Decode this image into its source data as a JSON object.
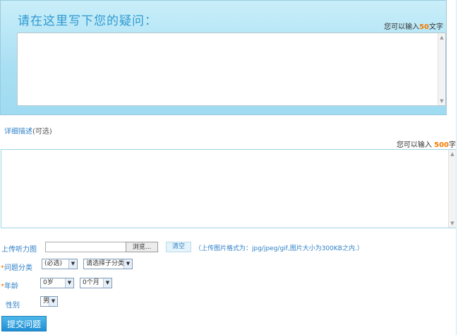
{
  "question": {
    "title": "请在这里写下您的疑问：",
    "hint_prefix": "您可以输入",
    "hint_number": "50",
    "hint_suffix": "文字"
  },
  "detail": {
    "label": "详细描述",
    "optional": "(可选)",
    "hint_prefix": "您可以输入",
    "hint_number": "500",
    "hint_suffix": "字"
  },
  "upload": {
    "label": "上传听力图",
    "browse_label": "浏览...",
    "clear_label": "清空",
    "note": "（上传图片格式为：jpg/jpeg/gif,图片大小为300KB之内.）"
  },
  "category": {
    "label": "问题分类",
    "select1": "(必选)",
    "select2": "请选择子分类"
  },
  "age": {
    "label": "年龄",
    "select1": "0岁",
    "select2": "0个月"
  },
  "gender": {
    "label": "性别",
    "select": "男"
  },
  "submit_label": "提交问题",
  "colors": {
    "accent": "#2f9ad2",
    "highlight": "#f27b00",
    "link": "#2f80c7"
  }
}
